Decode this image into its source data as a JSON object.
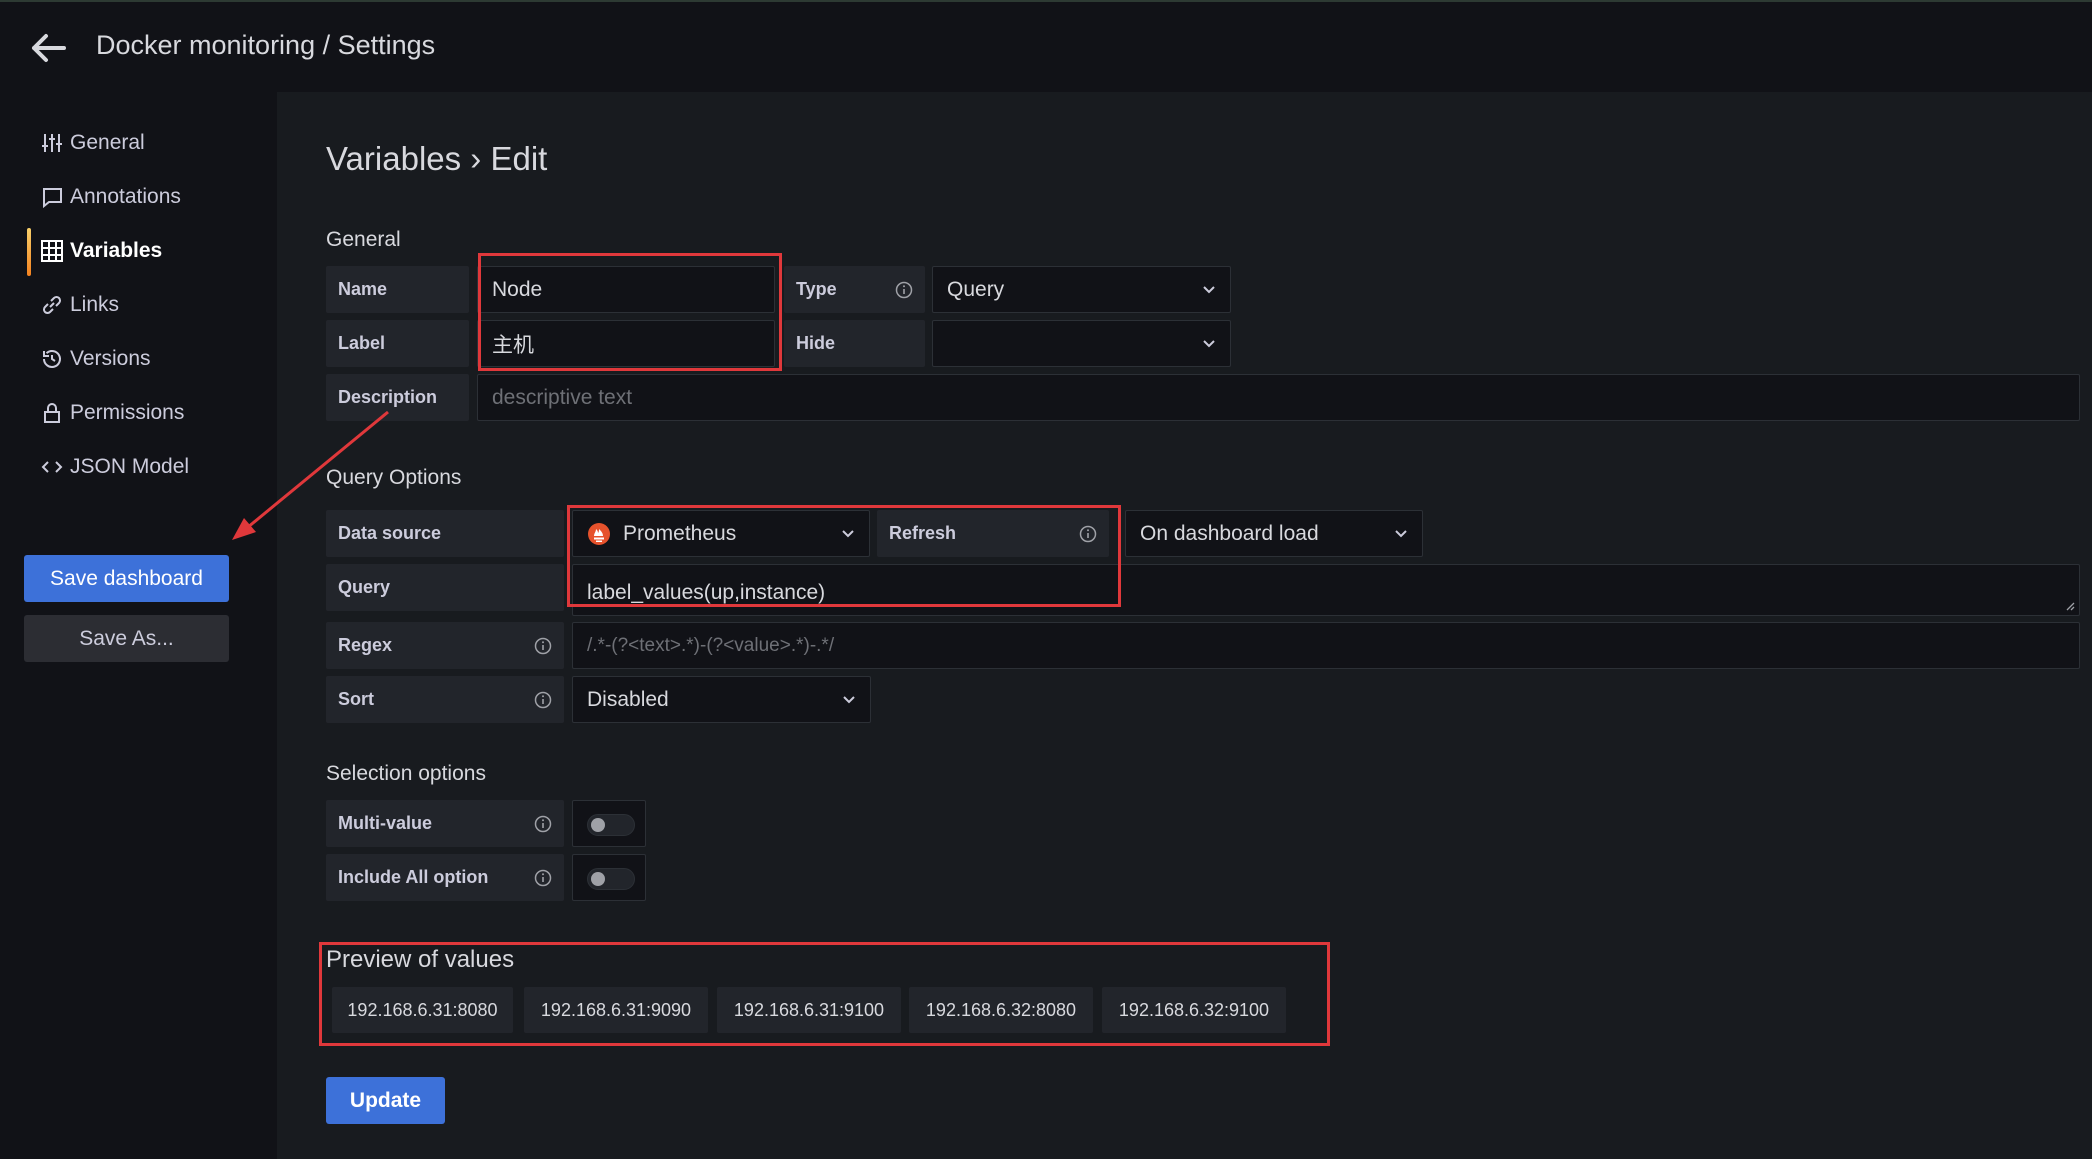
{
  "header": {
    "breadcrumb": "Docker monitoring / Settings"
  },
  "sidebar": {
    "items": [
      {
        "label": "General",
        "icon": "sliders-icon"
      },
      {
        "label": "Annotations",
        "icon": "comment-icon"
      },
      {
        "label": "Variables",
        "icon": "calculator-icon",
        "active": true
      },
      {
        "label": "Links",
        "icon": "link-icon"
      },
      {
        "label": "Versions",
        "icon": "history-icon"
      },
      {
        "label": "Permissions",
        "icon": "lock-icon"
      },
      {
        "label": "JSON Model",
        "icon": "code-icon"
      }
    ],
    "save_label": "Save dashboard",
    "save_as_label": "Save As..."
  },
  "page": {
    "title": "Variables › Edit"
  },
  "general": {
    "title": "General",
    "name_label": "Name",
    "name_value": "Node",
    "type_label": "Type",
    "type_value": "Query",
    "label_label": "Label",
    "label_value": "主机",
    "hide_label": "Hide",
    "hide_value": "",
    "description_label": "Description",
    "description_placeholder": "descriptive text"
  },
  "query_options": {
    "title": "Query Options",
    "datasource_label": "Data source",
    "datasource_value": "Prometheus",
    "refresh_label": "Refresh",
    "refresh_value": "On dashboard load",
    "query_label": "Query",
    "query_value": "label_values(up,instance)",
    "regex_label": "Regex",
    "regex_placeholder": "/.*-(?<text>.*)-(?<value>.*)-.*/",
    "sort_label": "Sort",
    "sort_value": "Disabled"
  },
  "selection_options": {
    "title": "Selection options",
    "multi_value_label": "Multi-value",
    "multi_value_on": false,
    "include_all_label": "Include All option",
    "include_all_on": false
  },
  "preview": {
    "title": "Preview of values",
    "values": [
      "192.168.6.31:8080",
      "192.168.6.31:9090",
      "192.168.6.31:9100",
      "192.168.6.32:8080",
      "192.168.6.32:9100"
    ]
  },
  "update_label": "Update",
  "colors": {
    "background": "#111217",
    "panel": "#181b1f",
    "primary": "#3d71d9",
    "highlight": "#e0383b",
    "prometheus": "#e6522c"
  }
}
